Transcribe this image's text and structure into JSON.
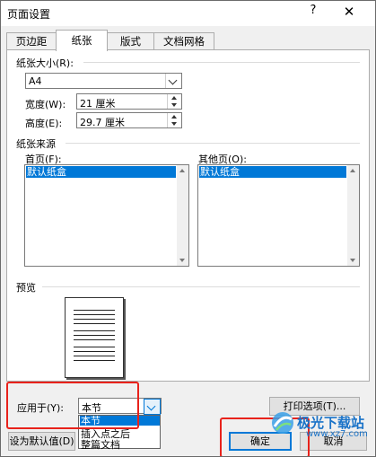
{
  "window": {
    "title": "页面设置",
    "help": "?",
    "close": "✕"
  },
  "tabs": [
    "页边距",
    "纸张",
    "版式",
    "文档网格"
  ],
  "paper_size": {
    "group_label": "纸张大小(R):",
    "selected": "A4",
    "width_label": "宽度(W):",
    "width_value": "21 厘米",
    "height_label": "高度(E):",
    "height_value": "29.7 厘米"
  },
  "paper_source": {
    "group_label": "纸张来源",
    "first_page_label": "首页(F):",
    "first_page_selected": "默认纸盒",
    "other_pages_label": "其他页(O):",
    "other_pages_selected": "默认纸盒"
  },
  "preview": {
    "label": "预览"
  },
  "apply": {
    "label": "应用于(Y):",
    "selected": "本节",
    "options": [
      "本节",
      "插入点之后",
      "整篇文档"
    ]
  },
  "buttons": {
    "print_options": "打印选项(T)...",
    "set_default": "设为默认值(D)",
    "ok": "确定",
    "cancel": "取消"
  },
  "watermark": {
    "brand": "极光下载站",
    "url": "www.xz7.com"
  },
  "colors": {
    "accent": "#0078d7",
    "highlight_box": "#e8221b"
  }
}
